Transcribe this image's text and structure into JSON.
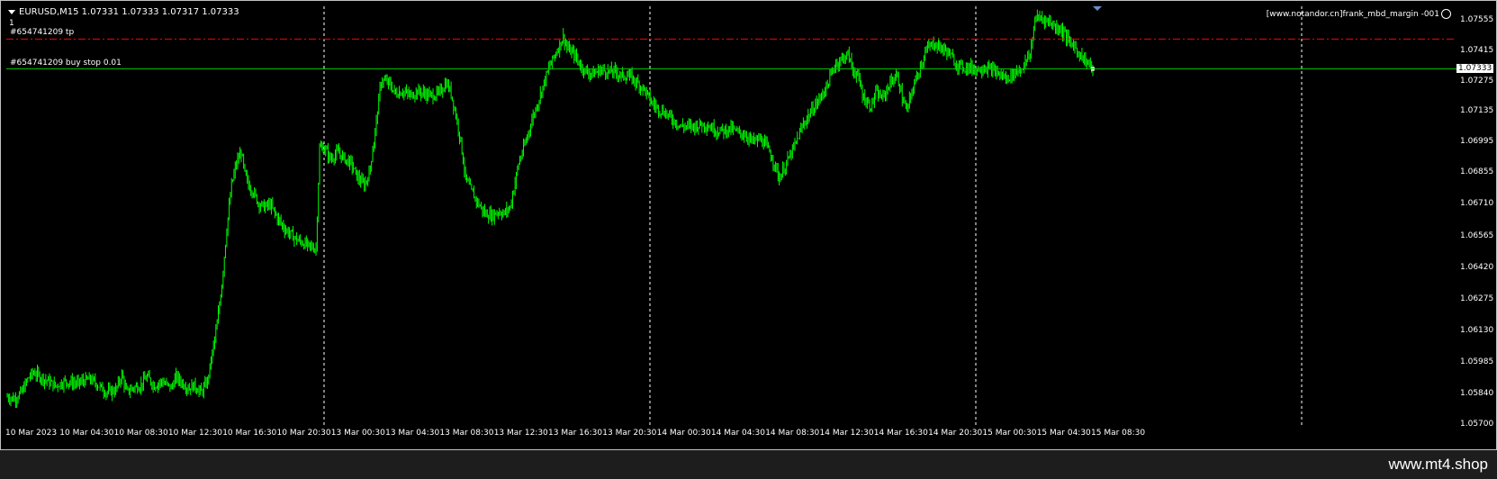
{
  "header": {
    "symbol_line": "EURUSD,M15  1.07331 1.07333 1.07317 1.07333",
    "sub_label": "1",
    "copyright": "[www.notandor.cn]frank_mbd_margin -001"
  },
  "orders": {
    "tp_label": "#654741209 tp",
    "tp_price": 1.0747,
    "entry_label": "#654741209 buy stop 0.01",
    "entry_price": 1.07333,
    "current_price_tag": "1.07333"
  },
  "colors": {
    "candle": "#00ff00",
    "tp_line": "#ff0000",
    "entry_line": "#00c000",
    "grid": "#ffffff",
    "background": "#000000"
  },
  "chart_data": {
    "type": "candlestick",
    "y_ticks": [
      "1.07555",
      "1.07415",
      "1.07275",
      "1.07135",
      "1.06995",
      "1.06855",
      "1.06710",
      "1.06565",
      "1.06420",
      "1.06275",
      "1.06130",
      "1.05985",
      "1.05840",
      "1.05700"
    ],
    "ylim": [
      1.057,
      1.0762
    ],
    "x_ticks": [
      "10 Mar 2023",
      "10 Mar 04:30",
      "10 Mar 08:30",
      "10 Mar 12:30",
      "10 Mar 16:30",
      "10 Mar 20:30",
      "13 Mar 00:30",
      "13 Mar 04:30",
      "13 Mar 08:30",
      "13 Mar 12:30",
      "13 Mar 16:30",
      "13 Mar 20:30",
      "14 Mar 00:30",
      "14 Mar 04:30",
      "14 Mar 08:30",
      "14 Mar 12:30",
      "14 Mar 16:30",
      "14 Mar 20:30",
      "15 Mar 00:30",
      "15 Mar 04:30",
      "15 Mar 08:30"
    ],
    "day_separators": [
      "13 Mar 00:00",
      "14 Mar 00:00",
      "15 Mar 00:00",
      "16 Mar 00:00"
    ],
    "path_points": [
      [
        0,
        1.0583
      ],
      [
        6,
        1.0582
      ],
      [
        12,
        1.0585
      ],
      [
        18,
        1.0592
      ],
      [
        22,
        1.0594
      ],
      [
        28,
        1.0592
      ],
      [
        34,
        1.059
      ],
      [
        40,
        1.0588
      ],
      [
        48,
        1.059
      ],
      [
        58,
        1.0589
      ],
      [
        62,
        1.059
      ],
      [
        69,
        1.0591
      ],
      [
        76,
        1.0588
      ],
      [
        82,
        1.0585
      ],
      [
        90,
        1.0586
      ],
      [
        95,
        1.0593
      ],
      [
        99,
        1.0585
      ],
      [
        104,
        1.0587
      ],
      [
        110,
        1.0588
      ],
      [
        116,
        1.0592
      ],
      [
        122,
        1.0588
      ],
      [
        128,
        1.059
      ],
      [
        136,
        1.0587
      ],
      [
        140,
        1.0592
      ],
      [
        144,
        1.059
      ],
      [
        150,
        1.0587
      ],
      [
        155,
        1.0588
      ],
      [
        161,
        1.0585
      ],
      [
        166,
        1.059
      ],
      [
        170,
        1.0603
      ],
      [
        174,
        1.0616
      ],
      [
        178,
        1.0635
      ],
      [
        182,
        1.066
      ],
      [
        186,
        1.068
      ],
      [
        190,
        1.069
      ],
      [
        194,
        1.0695
      ],
      [
        197,
        1.0685
      ],
      [
        200,
        1.068
      ],
      [
        204,
        1.0677
      ],
      [
        208,
        1.0672
      ],
      [
        213,
        1.067
      ],
      [
        218,
        1.0671
      ],
      [
        224,
        1.0665
      ],
      [
        230,
        1.066
      ],
      [
        240,
        1.0655
      ],
      [
        250,
        1.0652
      ],
      [
        256,
        1.0651
      ],
      [
        259,
        1.0697
      ],
      [
        263,
        1.0697
      ],
      [
        268,
        1.0692
      ],
      [
        274,
        1.0695
      ],
      [
        280,
        1.0692
      ],
      [
        285,
        1.069
      ],
      [
        290,
        1.0684
      ],
      [
        296,
        1.068
      ],
      [
        300,
        1.0685
      ],
      [
        304,
        1.07
      ],
      [
        310,
        1.0728
      ],
      [
        316,
        1.0727
      ],
      [
        322,
        1.0722
      ],
      [
        328,
        1.0723
      ],
      [
        334,
        1.0721
      ],
      [
        340,
        1.0723
      ],
      [
        346,
        1.0722
      ],
      [
        352,
        1.0721
      ],
      [
        358,
        1.0722
      ],
      [
        364,
        1.0727
      ],
      [
        368,
        1.0722
      ],
      [
        372,
        1.0712
      ],
      [
        376,
        1.07
      ],
      [
        380,
        1.0683
      ],
      [
        385,
        1.0677
      ],
      [
        390,
        1.0672
      ],
      [
        396,
        1.0667
      ],
      [
        402,
        1.0666
      ],
      [
        407,
        1.0668
      ],
      [
        412,
        1.0667
      ],
      [
        417,
        1.067
      ],
      [
        424,
        1.069
      ],
      [
        430,
        1.07
      ],
      [
        435,
        1.071
      ],
      [
        440,
        1.0718
      ],
      [
        445,
        1.0727
      ],
      [
        450,
        1.0735
      ],
      [
        456,
        1.0742
      ],
      [
        461,
        1.0748
      ],
      [
        465,
        1.0742
      ],
      [
        470,
        1.074
      ],
      [
        475,
        1.0735
      ],
      [
        480,
        1.0732
      ],
      [
        486,
        1.0731
      ],
      [
        492,
        1.0733
      ],
      [
        498,
        1.0732
      ],
      [
        504,
        1.0732
      ],
      [
        510,
        1.073
      ],
      [
        516,
        1.073
      ],
      [
        522,
        1.0727
      ],
      [
        528,
        1.0724
      ],
      [
        534,
        1.0718
      ],
      [
        540,
        1.0715
      ],
      [
        546,
        1.0713
      ],
      [
        552,
        1.071
      ],
      [
        558,
        1.0707
      ],
      [
        564,
        1.0707
      ],
      [
        570,
        1.0707
      ],
      [
        576,
        1.0708
      ],
      [
        582,
        1.0707
      ],
      [
        588,
        1.0705
      ],
      [
        594,
        1.0705
      ],
      [
        600,
        1.0706
      ],
      [
        606,
        1.0704
      ],
      [
        612,
        1.0703
      ],
      [
        618,
        1.07
      ],
      [
        624,
        1.0701
      ],
      [
        628,
        1.0699
      ],
      [
        632,
        1.0695
      ],
      [
        636,
        1.069
      ],
      [
        640,
        1.0683
      ],
      [
        646,
        1.069
      ],
      [
        652,
        1.0697
      ],
      [
        660,
        1.0708
      ],
      [
        668,
        1.0715
      ],
      [
        674,
        1.072
      ],
      [
        680,
        1.0726
      ],
      [
        686,
        1.0735
      ],
      [
        692,
        1.0738
      ],
      [
        697,
        1.074
      ],
      [
        701,
        1.0733
      ],
      [
        705,
        1.073
      ],
      [
        710,
        1.072
      ],
      [
        716,
        1.0716
      ],
      [
        720,
        1.0722
      ],
      [
        726,
        1.072
      ],
      [
        732,
        1.0727
      ],
      [
        738,
        1.073
      ],
      [
        742,
        1.072
      ],
      [
        746,
        1.0714
      ],
      [
        750,
        1.0723
      ],
      [
        756,
        1.0733
      ],
      [
        762,
        1.0742
      ],
      [
        768,
        1.0745
      ],
      [
        774,
        1.0743
      ],
      [
        780,
        1.0741
      ],
      [
        786,
        1.0736
      ],
      [
        792,
        1.0734
      ],
      [
        798,
        1.0734
      ],
      [
        804,
        1.0733
      ],
      [
        810,
        1.0734
      ],
      [
        816,
        1.0733
      ],
      [
        822,
        1.0731
      ],
      [
        828,
        1.0729
      ],
      [
        832,
        1.073
      ],
      [
        836,
        1.0732
      ],
      [
        840,
        1.0733
      ],
      [
        844,
        1.0736
      ],
      [
        848,
        1.074
      ],
      [
        852,
        1.0756
      ],
      [
        856,
        1.0757
      ],
      [
        860,
        1.0756
      ],
      [
        864,
        1.0755
      ],
      [
        868,
        1.0753
      ],
      [
        872,
        1.0752
      ],
      [
        876,
        1.075
      ],
      [
        880,
        1.0746
      ],
      [
        884,
        1.0744
      ],
      [
        888,
        1.0741
      ],
      [
        892,
        1.0738
      ],
      [
        896,
        1.0736
      ],
      [
        900,
        1.07333
      ]
    ]
  },
  "watermark": "www.mt4.shop"
}
